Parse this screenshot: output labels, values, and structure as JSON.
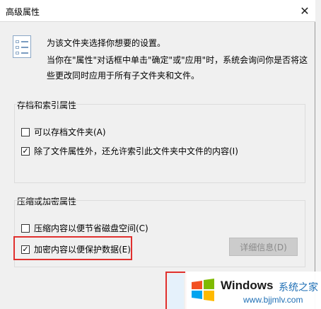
{
  "window": {
    "title": "高级属性",
    "close_glyph": "✕"
  },
  "intro": {
    "line1": "为该文件夹选择你想要的设置。",
    "line2": "当你在\"属性\"对话框中单击\"确定\"或\"应用\"时，系统会询问你是否将这些更改同时应用于所有子文件夹和文件。"
  },
  "archive_group": {
    "title": "存档和索引属性",
    "options": [
      {
        "label": "可以存档文件夹(A)",
        "checked": false
      },
      {
        "label": "除了文件属性外，还允许索引此文件夹中文件的内容(I)",
        "checked": true
      }
    ]
  },
  "compress_group": {
    "title": "压缩或加密属性",
    "options": [
      {
        "label": "压缩内容以便节省磁盘空间(C)",
        "checked": false
      },
      {
        "label": "加密内容以便保护数据(E)",
        "checked": true
      }
    ],
    "details_button": "详细信息(D)"
  },
  "watermark": {
    "brand": "Windows",
    "site_name": "系统之家",
    "url": "www.bjjmlv.com",
    "logo_colors": [
      "#f25022",
      "#7fba00",
      "#00a4ef",
      "#ffb900"
    ]
  }
}
